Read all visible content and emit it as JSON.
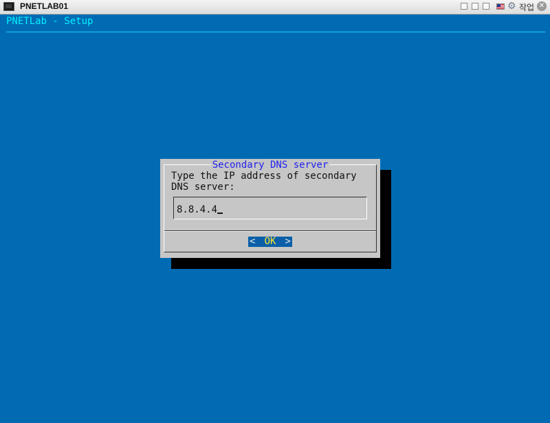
{
  "window": {
    "title": "PNETLAB01",
    "work_label": "작업",
    "gear_icon": "gear-icon",
    "flag_icon": "us-flag-icon",
    "close_icon": "close-icon"
  },
  "console": {
    "title": "PNETLab - Setup"
  },
  "dialog": {
    "title": "Secondary DNS server",
    "prompt": "Type the IP address of secondary DNS server:",
    "input_value": "8.8.4.4",
    "ok_left": "<",
    "ok_label": "OK",
    "ok_right": ">"
  },
  "colors": {
    "background": "#006bb3",
    "console_title": "#00f0ff",
    "dialog": "#c6c6c6",
    "dialog_title": "#2222ee",
    "button_bg": "#0a5fa8",
    "button_label": "#ffe633"
  }
}
